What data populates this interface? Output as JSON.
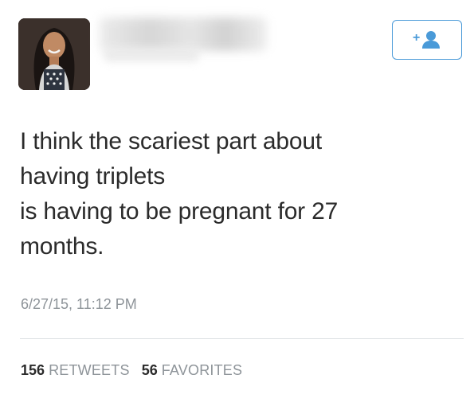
{
  "tweet": {
    "text_lines": [
      "I think the scariest part about",
      "having triplets",
      "is having to be pregnant for 27",
      "months."
    ],
    "timestamp": "6/27/15, 11:12 PM"
  },
  "stats": {
    "retweets_count": "156",
    "retweets_label": "RETWEETS",
    "favorites_count": "56",
    "favorites_label": "FAVORITES"
  },
  "follow_button": {
    "icon": "add-user-icon"
  },
  "colors": {
    "accent": "#4a9ad8",
    "text": "#2b2b2b",
    "muted": "#8e9499",
    "divider": "#dcdfe2"
  }
}
